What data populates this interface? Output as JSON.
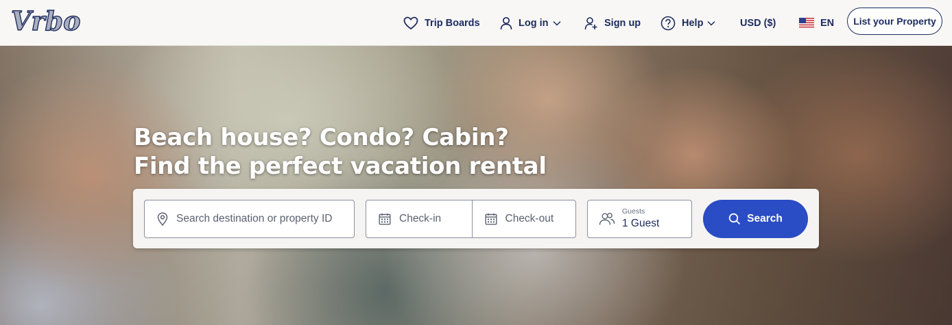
{
  "brand": {
    "logo_text": "Vrbo",
    "color": "#1c2b5e"
  },
  "header": {
    "trip_boards": {
      "label": "Trip Boards",
      "icon": "heart-icon"
    },
    "log_in": {
      "label": "Log in",
      "icon": "user-icon"
    },
    "sign_up": {
      "label": "Sign up",
      "icon": "add-user-icon"
    },
    "help": {
      "label": "Help",
      "icon": "question-icon"
    },
    "currency": {
      "label": "USD ($)"
    },
    "language": {
      "label": "EN",
      "icon": "us-flag-icon"
    },
    "list_property": {
      "label": "List your Property"
    }
  },
  "hero": {
    "title_line1": "Beach house? Condo? Cabin?",
    "title_line2": "Find the perfect vacation rental"
  },
  "search": {
    "destination_placeholder": "Search destination or property ID",
    "checkin_placeholder": "Check-in",
    "checkout_placeholder": "Check-out",
    "guests_label": "Guests",
    "guests_value": "1 Guest",
    "button_label": "Search",
    "button_color": "#2a4cc4"
  }
}
